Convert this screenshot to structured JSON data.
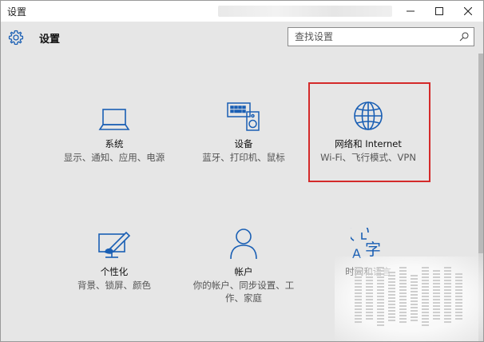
{
  "window": {
    "title": "设置",
    "controls": [
      "minimize",
      "maximize",
      "close"
    ]
  },
  "header": {
    "title": "设置",
    "search": {
      "placeholder": "查找设置",
      "value": ""
    }
  },
  "tiles": [
    {
      "icon": "laptop-icon",
      "name": "系统",
      "desc": "显示、通知、应用、电源"
    },
    {
      "icon": "keyboard-speaker-icon",
      "name": "设备",
      "desc": "蓝牙、打印机、鼠标"
    },
    {
      "icon": "globe-icon",
      "name": "网络和 Internet",
      "desc": "Wi-Fi、飞行模式、VPN",
      "highlighted": true
    },
    {
      "icon": "paint-brush-icon",
      "name": "个性化",
      "desc": "背景、锁屏、颜色"
    },
    {
      "icon": "person-icon",
      "name": "帐户",
      "desc": "你的帐户、同步设置、工作、家庭"
    },
    {
      "icon": "time-language-icon",
      "name": "时间和语言",
      "desc": ""
    }
  ],
  "colors": {
    "accent": "#1a5fb4",
    "highlight_border": "#d42a2a",
    "background": "#e6e6e6"
  }
}
